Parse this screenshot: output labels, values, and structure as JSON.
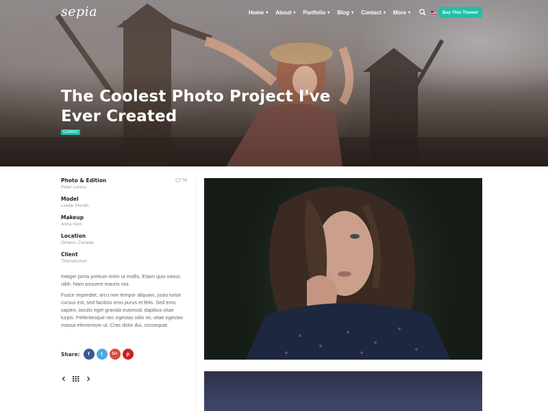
{
  "brand": {
    "logo": "sepia"
  },
  "nav": {
    "items": [
      {
        "label": "Home"
      },
      {
        "label": "About"
      },
      {
        "label": "Portfolio"
      },
      {
        "label": "Blog"
      },
      {
        "label": "Contact"
      },
      {
        "label": "More"
      }
    ],
    "language": "EN",
    "cta_label": "Buy This Theme!"
  },
  "hero": {
    "title": "The Coolest Photo Project I've Ever Created",
    "category": "Outdoor"
  },
  "project": {
    "likes": "56",
    "meta": [
      {
        "label": "Photo & Edition",
        "value": "Peter Lorens"
      },
      {
        "label": "Model",
        "value": "Liselle Shmith"
      },
      {
        "label": "Makeup",
        "value": "Anna Vent"
      },
      {
        "label": "Location",
        "value": "Ontario, Canada"
      },
      {
        "label": "Client",
        "value": "Themetorium"
      }
    ],
    "description": [
      "Integer porta pretium enim ut mollis. Etiam quis varius nibh. Nam posuere mauris nisi.",
      "Fusce imperdiet, arcu non tempor aliquam, justo tortor cursus est, sed facilisis eros purus et felis. Sed eros sapien, iaculis eget gravida euismod, dapibus vitae turpis. Pellentesque nec egestas odio mi, vitae egestas massa elementum ut. Cras dolor dui, consequat."
    ],
    "share_label": "Share:",
    "social": [
      "f",
      "t",
      "G+",
      "p"
    ]
  },
  "colors": {
    "accent": "#1fc0a8",
    "facebook": "#3b5998",
    "twitter": "#4ca9e1",
    "google_plus": "#dd4b39",
    "pinterest": "#cb2027"
  },
  "icons": {
    "search": "search-icon",
    "heart": "heart-icon",
    "prev": "chevron-left-icon",
    "grid": "grid-icon",
    "next": "chevron-right-icon"
  }
}
